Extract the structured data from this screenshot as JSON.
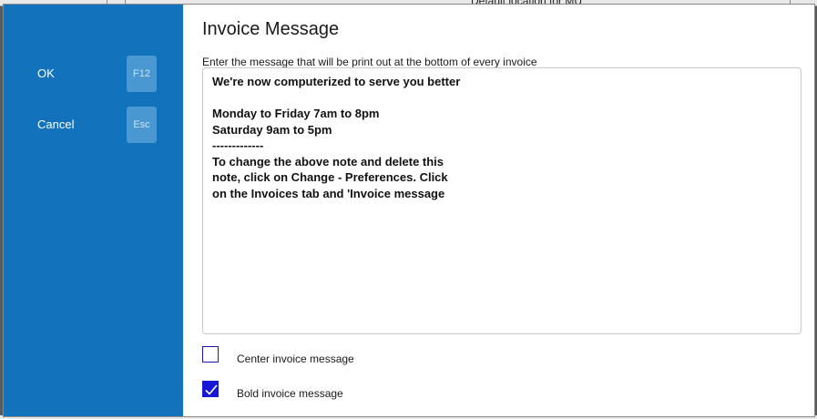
{
  "background": {
    "partial_text": "Default location for MU"
  },
  "sidebar": {
    "ok": {
      "label": "OK",
      "key": "F12"
    },
    "cancel": {
      "label": "Cancel",
      "key": "Esc"
    }
  },
  "dialog": {
    "title": "Invoice Message",
    "description": "Enter the message that will be print out at the bottom of every invoice",
    "message": "We're now computerized to serve you better\n\nMonday to Friday 7am to 8pm\nSaturday 9am to 5pm\n-------------\nTo change the above note and delete this\nnote, click on Change - Preferences. Click\non the Invoices tab and 'Invoice message",
    "center_message": {
      "label": "Center invoice message",
      "checked": false
    },
    "bold_message": {
      "label": "Bold invoice message",
      "checked": true
    }
  },
  "colors": {
    "sidebar": "#1273bc",
    "key_badge": "#4a98d1",
    "checkbox_checked": "#1717d6"
  }
}
